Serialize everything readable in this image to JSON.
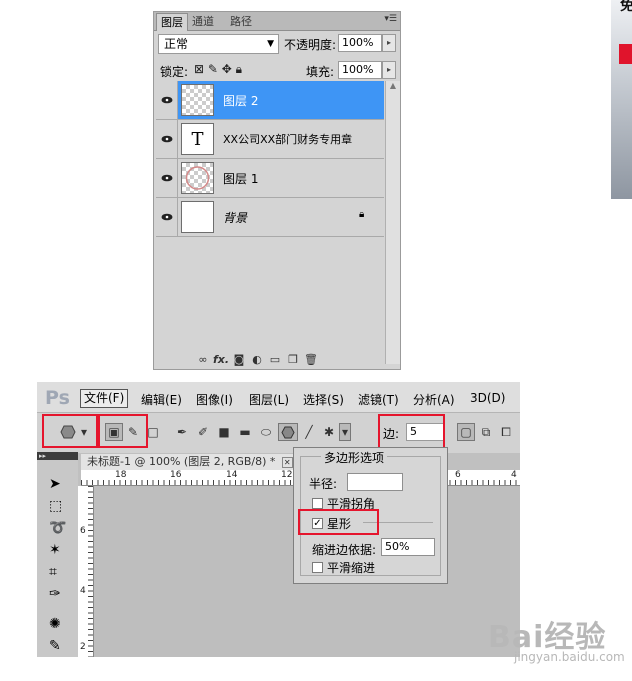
{
  "layers_panel": {
    "tabs": [
      "图层",
      "通道",
      "路径"
    ],
    "blend_mode": "正常",
    "opacity_label": "不透明度:",
    "opacity_value": "100%",
    "lock_label": "锁定:",
    "fill_label": "填充:",
    "fill_value": "100%",
    "layers": [
      {
        "name": "图层 2",
        "selected": true,
        "thumb": "transparent"
      },
      {
        "name": "XX公司XX部门财务专用章",
        "selected": false,
        "thumb": "text",
        "thumb_glyph": "T"
      },
      {
        "name": "图层 1",
        "selected": false,
        "thumb": "transparent-stamp"
      },
      {
        "name": "背景",
        "selected": false,
        "thumb": "white",
        "locked": true
      }
    ],
    "footer_icons": [
      "link-icon",
      "fx-icon",
      "mask-icon",
      "adjustment-icon",
      "group-icon",
      "new-layer-icon",
      "trash-icon"
    ],
    "fx_label": "fx."
  },
  "photoshop": {
    "logo": "Ps",
    "menu": [
      "文件(F)",
      "编辑(E)",
      "图像(I)",
      "图层(L)",
      "选择(S)",
      "滤镜(T)",
      "分析(A)",
      "3D(D)"
    ],
    "sides_label": "边:",
    "sides_value": "5",
    "document_tab": "未标题-1 @ 100% (图层 2, RGB/8) *",
    "ruler_h_labels": [
      "18",
      "16",
      "14",
      "12",
      "6",
      "4"
    ],
    "ruler_v_labels": [
      "6",
      "4",
      "2"
    ]
  },
  "polygon_options": {
    "title": "多边形选项",
    "radius_label": "半径:",
    "radius_value": "",
    "smooth_corners_label": "平滑拐角",
    "smooth_corners_checked": false,
    "star_label": "星形",
    "star_checked": true,
    "indent_label": "缩进边依据:",
    "indent_value": "50%",
    "smooth_indents_label": "平滑缩进",
    "smooth_indents_checked": false
  },
  "photo_fragment": {
    "text": "免"
  },
  "watermark": {
    "brand": "Bai经验",
    "url": "jingyan.baidu.com"
  },
  "colors": {
    "selection_blue": "#3e95f5",
    "highlight_red": "#e5152d"
  }
}
